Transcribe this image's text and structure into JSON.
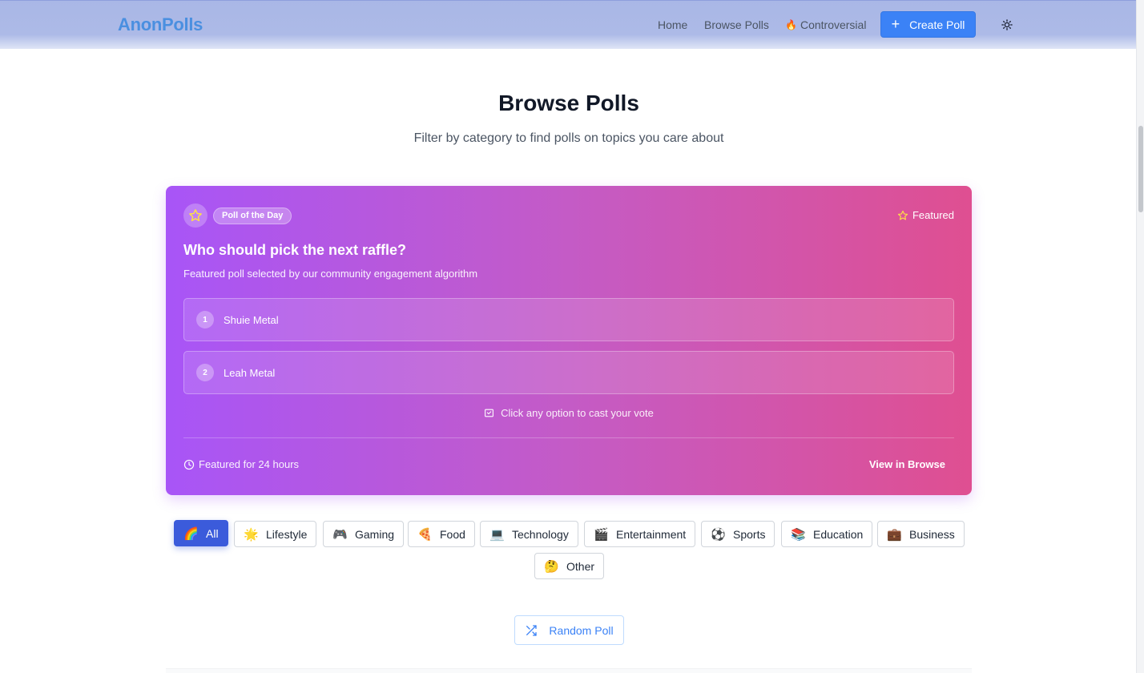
{
  "header": {
    "logo": "AnonPolls",
    "nav": {
      "home": "Home",
      "browse": "Browse Polls",
      "controversial": "Controversial"
    },
    "create_label": "Create Poll"
  },
  "page": {
    "title": "Browse Polls",
    "subtitle": "Filter by category to find polls on topics you care about"
  },
  "poll_of_day": {
    "badge": "Poll of the Day",
    "featured": "Featured",
    "question": "Who should pick the next raffle?",
    "description": "Featured poll selected by our community engagement algorithm",
    "options": [
      {
        "num": "1",
        "text": "Shuie Metal"
      },
      {
        "num": "2",
        "text": "Leah Metal"
      }
    ],
    "hint": "Click any option to cast your vote",
    "duration": "Featured for 24 hours",
    "view_link": "View in Browse"
  },
  "categories": [
    {
      "emoji": "🌈",
      "label": "All",
      "active": true
    },
    {
      "emoji": "🌟",
      "label": "Lifestyle"
    },
    {
      "emoji": "🎮",
      "label": "Gaming"
    },
    {
      "emoji": "🍕",
      "label": "Food"
    },
    {
      "emoji": "💻",
      "label": "Technology"
    },
    {
      "emoji": "🎬",
      "label": "Entertainment"
    },
    {
      "emoji": "⚽",
      "label": "Sports"
    },
    {
      "emoji": "📚",
      "label": "Education"
    },
    {
      "emoji": "💼",
      "label": "Business"
    },
    {
      "emoji": "🤔",
      "label": "Other"
    }
  ],
  "random_label": "Random Poll",
  "colors": {
    "accent": "#3b82f6",
    "active_chip": "#3b5bdb",
    "card_gradient_start": "#a855f7",
    "card_gradient_end": "#df4f91"
  }
}
